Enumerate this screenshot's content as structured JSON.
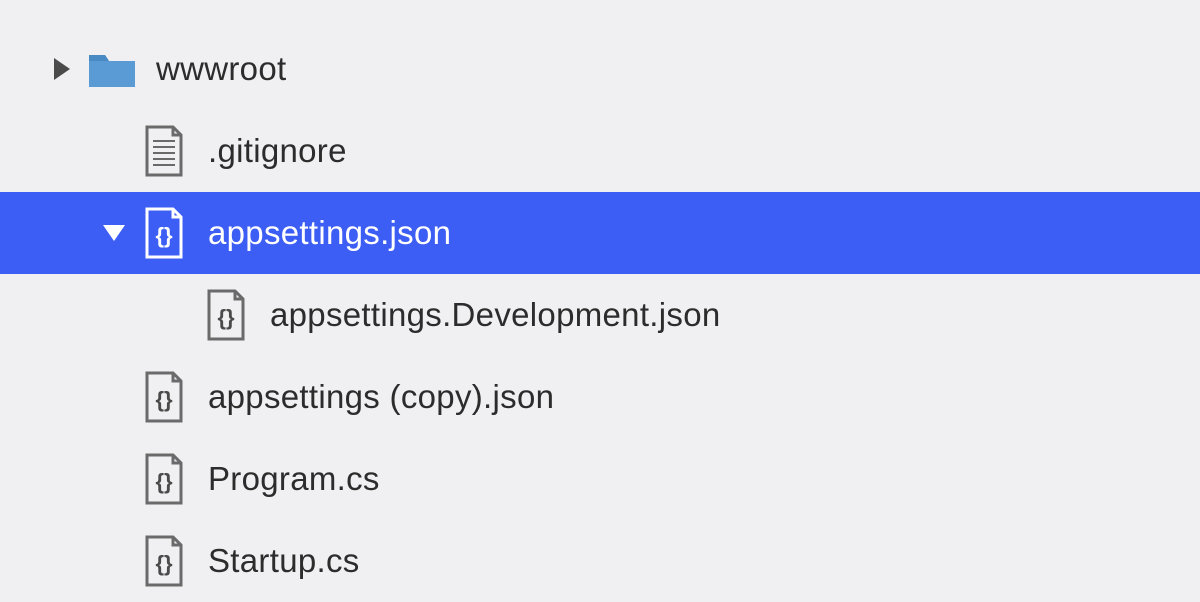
{
  "tree": {
    "items": [
      {
        "label": "wwwroot",
        "icon": "folder",
        "expandable": true,
        "expanded": false,
        "selected": false,
        "indent": 0
      },
      {
        "label": ".gitignore",
        "icon": "textfile",
        "expandable": false,
        "expanded": false,
        "selected": false,
        "indent": 1
      },
      {
        "label": "appsettings.json",
        "icon": "codefile",
        "expandable": true,
        "expanded": true,
        "selected": true,
        "indent": 1
      },
      {
        "label": "appsettings.Development.json",
        "icon": "codefile",
        "expandable": false,
        "expanded": false,
        "selected": false,
        "indent": 2
      },
      {
        "label": "appsettings (copy).json",
        "icon": "codefile",
        "expandable": false,
        "expanded": false,
        "selected": false,
        "indent": 1
      },
      {
        "label": "Program.cs",
        "icon": "codefile",
        "expandable": false,
        "expanded": false,
        "selected": false,
        "indent": 1
      },
      {
        "label": "Startup.cs",
        "icon": "codefile",
        "expandable": false,
        "expanded": false,
        "selected": false,
        "indent": 1
      }
    ]
  }
}
